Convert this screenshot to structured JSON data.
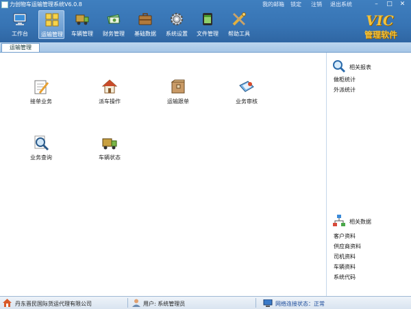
{
  "window": {
    "title": "力创物车运输管理系统V6.0.8"
  },
  "top_links": [
    "我的邮箱",
    "锁定",
    "注销",
    "退出系统"
  ],
  "toolbar": [
    {
      "label": "工作台",
      "icon": "workbench-icon"
    },
    {
      "label": "运输管理",
      "icon": "transport-icon",
      "active": true
    },
    {
      "label": "车辆管理",
      "icon": "truck-icon"
    },
    {
      "label": "财务管理",
      "icon": "finance-icon"
    },
    {
      "label": "基础数据",
      "icon": "briefcase-icon"
    },
    {
      "label": "系统设置",
      "icon": "gear-icon"
    },
    {
      "label": "文件管理",
      "icon": "file-icon"
    },
    {
      "label": "帮助工具",
      "icon": "tools-icon"
    }
  ],
  "logo": {
    "brand": "VIC",
    "subtitle": "管理软件"
  },
  "tabs": [
    {
      "label": "运输管理"
    }
  ],
  "functions": [
    {
      "label": "接单业务",
      "icon": "order-edit-icon"
    },
    {
      "label": "派车操作",
      "icon": "dispatch-house-icon"
    },
    {
      "label": "运输跟单",
      "icon": "cargo-box-icon"
    },
    {
      "label": "业务审核",
      "icon": "audit-icon"
    },
    {
      "label": "业务查询",
      "icon": "magnifier-icon"
    },
    {
      "label": "车辆状态",
      "icon": "vehicle-status-icon"
    }
  ],
  "right_panel": {
    "reports": {
      "title": "相关报表",
      "items": [
        "做柜统计",
        "外派统计"
      ]
    },
    "data": {
      "title": "相关数据",
      "items": [
        "客户资料",
        "供应商资料",
        "司机资料",
        "车辆资料",
        "系统代码"
      ]
    }
  },
  "status": {
    "company": "丹东晋民国际货运代理有限公司",
    "user": "用户: 系统管理员",
    "network": "网络连接状态：正常"
  },
  "colors": {
    "header": "#3774b4",
    "accent_gold": "#f2c13a"
  }
}
